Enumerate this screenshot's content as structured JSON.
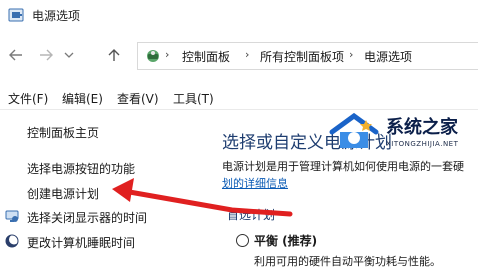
{
  "window": {
    "title": "电源选项",
    "icon": "power-options-icon"
  },
  "nav": {
    "back_icon": "arrow-left-icon",
    "forward_icon": "arrow-right-icon",
    "recent_icon": "chevron-down-icon",
    "up_icon": "arrow-up-icon",
    "breadcrumb": [
      "控制面板",
      "所有控制面板项",
      "电源选项"
    ],
    "separator": "›"
  },
  "menu": {
    "items": [
      "文件(F)",
      "编辑(E)",
      "查看(V)",
      "工具(T)"
    ]
  },
  "sidebar": {
    "home": "控制面板主页",
    "items": [
      {
        "label": "选择电源按钮的功能",
        "icon": ""
      },
      {
        "label": "创建电源计划",
        "icon": ""
      },
      {
        "label": "选择关闭显示器的时间",
        "icon": "display-icon"
      },
      {
        "label": "更改计算机睡眠时间",
        "icon": "moon-icon"
      }
    ]
  },
  "main": {
    "heading": "选择或自定义电源计划",
    "description": "电源计划是用于管理计算机如何使用电源的一套硬",
    "link": "划的详细信息",
    "section_title": "首选计划",
    "plans": [
      {
        "name": "平衡 (推荐)",
        "description": "利用可用的硬件自动平衡功耗与性能。",
        "selected": false
      }
    ]
  },
  "watermark": {
    "title": "系统之家",
    "subtitle": "XITONGZHIJIA.NET"
  },
  "colors": {
    "heading": "#1e3d70",
    "link": "#0b5bb5",
    "arrow": "#e02020"
  }
}
